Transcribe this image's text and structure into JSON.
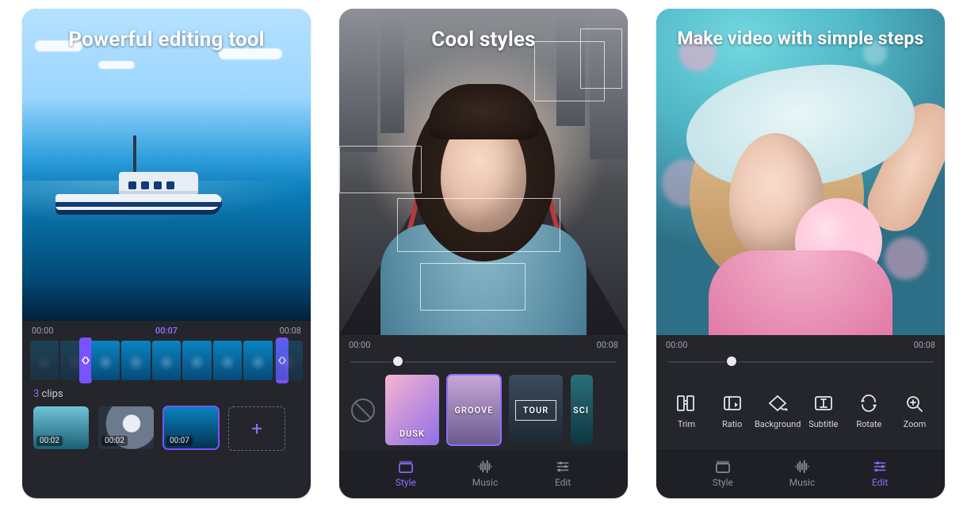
{
  "screens": [
    {
      "title": "Powerful editing tool",
      "timeline": {
        "start": "00:00",
        "current": "00:07",
        "end": "00:08"
      },
      "clips_count": "3",
      "clips_word": "clips",
      "clips": [
        {
          "duration": "00:02",
          "selected": false
        },
        {
          "duration": "00:02",
          "selected": false
        },
        {
          "duration": "00:07",
          "selected": true
        }
      ]
    },
    {
      "title": "Cool styles",
      "timeline": {
        "start": "00:00",
        "end": "00:08",
        "progress": 0.18
      },
      "styles": [
        {
          "name": "DUSK",
          "selected": false
        },
        {
          "name": "GROOVE",
          "selected": true
        },
        {
          "name": "TOUR",
          "selected": false
        },
        {
          "name": "SCI",
          "selected": false
        }
      ],
      "nav": {
        "style": "Style",
        "music": "Music",
        "edit": "Edit",
        "active": "style"
      }
    },
    {
      "title": "Make video with simple steps",
      "timeline": {
        "start": "00:00",
        "end": "00:08",
        "progress": 0.24
      },
      "tools": [
        {
          "id": "trim",
          "label": "Trim"
        },
        {
          "id": "ratio",
          "label": "Ratio"
        },
        {
          "id": "background",
          "label": "Background"
        },
        {
          "id": "subtitle",
          "label": "Subtitle"
        },
        {
          "id": "rotate",
          "label": "Rotate"
        },
        {
          "id": "zoom",
          "label": "Zoom"
        }
      ],
      "nav": {
        "style": "Style",
        "music": "Music",
        "edit": "Edit",
        "active": "edit"
      }
    }
  ],
  "colors": {
    "accent": "#8c6dff",
    "panel": "#25262b",
    "navbg": "#1f2026"
  }
}
